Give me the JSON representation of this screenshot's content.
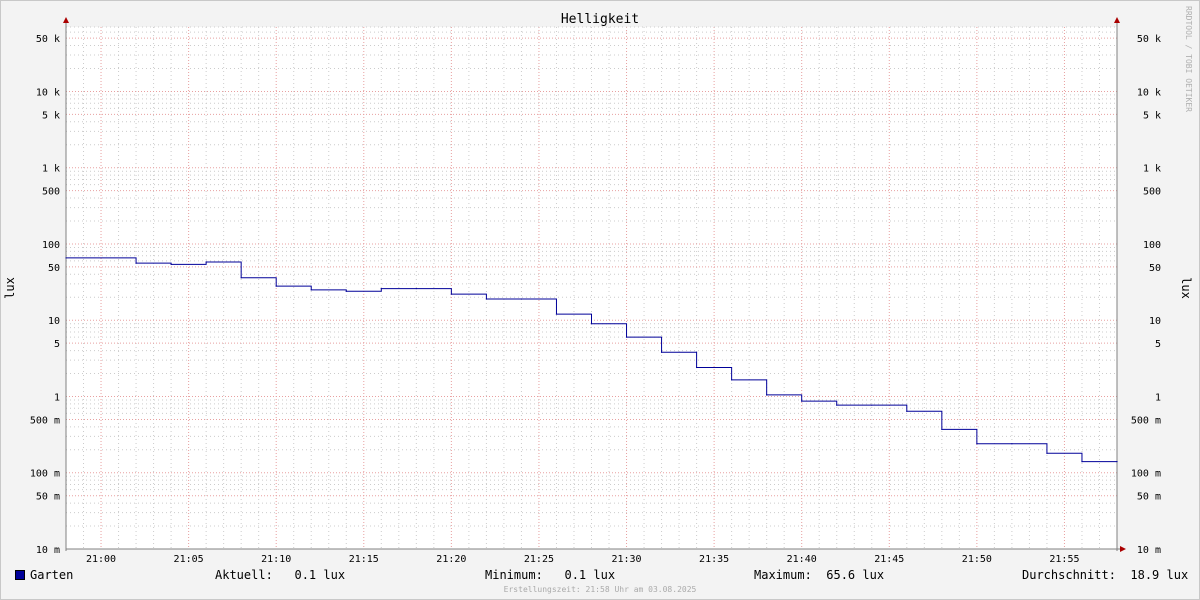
{
  "chart_data": {
    "type": "line",
    "title": "Helligkeit",
    "ylabel": "lux",
    "ylabel_right": "lux",
    "yscale": "log",
    "ylim": [
      10,
      70000
    ],
    "xlim": [
      "20:58",
      "21:58"
    ],
    "x_ticks": [
      "21:00",
      "21:05",
      "21:10",
      "21:15",
      "21:20",
      "21:25",
      "21:30",
      "21:35",
      "21:40",
      "21:45",
      "21:50",
      "21:55"
    ],
    "y_ticks": [
      {
        "value": 50000,
        "label": "50 k"
      },
      {
        "value": 10000,
        "label": "10 k"
      },
      {
        "value": 5000,
        "label": "5 k"
      },
      {
        "value": 1000,
        "label": "1 k"
      },
      {
        "value": 500,
        "label": "500"
      },
      {
        "value": 100,
        "label": "100"
      },
      {
        "value": 50,
        "label": "50"
      },
      {
        "value": 10,
        "label": "10"
      },
      {
        "value": 5,
        "label": "5"
      },
      {
        "value": 1,
        "label": "1"
      },
      {
        "value": 0.5,
        "label": "500 m"
      },
      {
        "value": 0.1,
        "label": "100 m"
      },
      {
        "value": 0.05,
        "label": "50 m"
      },
      {
        "value": 0.01,
        "label": "10 m"
      }
    ],
    "grid": true,
    "legend_position": "bottom-left",
    "series": [
      {
        "name": "Garten",
        "color": "#000099",
        "step": true,
        "x": [
          "20:58",
          "21:02",
          "21:04",
          "21:06",
          "21:08",
          "21:10",
          "21:12",
          "21:14",
          "21:16",
          "21:18",
          "21:20",
          "21:22",
          "21:24",
          "21:26",
          "21:28",
          "21:30",
          "21:32",
          "21:34",
          "21:36",
          "21:38",
          "21:40",
          "21:42",
          "21:44",
          "21:46",
          "21:48",
          "21:50",
          "21:52",
          "21:54",
          "21:56",
          "21:58"
        ],
        "values": [
          65.6,
          56,
          54,
          58,
          36,
          28,
          25,
          24,
          26,
          26,
          22,
          19,
          19,
          12,
          9,
          6,
          3.8,
          2.4,
          1.65,
          1.05,
          0.87,
          0.77,
          0.77,
          0.64,
          0.37,
          0.24,
          0.24,
          0.18,
          0.14,
          0.14
        ]
      }
    ]
  },
  "legend": {
    "series_name": "Garten",
    "series_color": "#000099",
    "aktuell": "Aktuell:   0.1 lux",
    "minimum": "Minimum:   0.1 lux",
    "maximum": "Maximum:  65.6 lux",
    "durchschnitt": "Durchschnitt:  18.9 lux"
  },
  "footer": "Erstellungszeit: 21:58 Uhr am 03.08.2025",
  "watermark": "RRDTOOL / TOBI OETIKER",
  "colors": {
    "background": "#f3f3f3",
    "plot_background": "#ffffff",
    "major_grid": "#e8a0a0",
    "minor_grid": "#cccccc",
    "axis": "#808080",
    "arrow": "#aa0000"
  }
}
